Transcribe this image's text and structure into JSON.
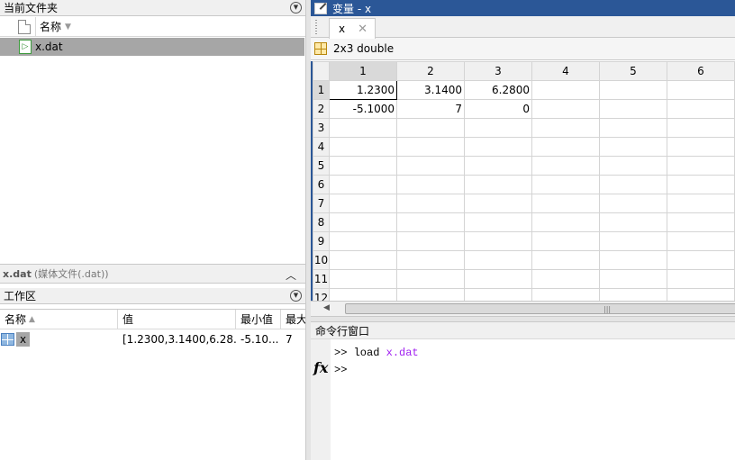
{
  "current_folder": {
    "title": "当前文件夹",
    "column_name": "名称",
    "files": [
      {
        "name": "x.dat"
      }
    ],
    "details_name": "x.dat",
    "details_desc": "(媒体文件(.dat))"
  },
  "workspace": {
    "title": "工作区",
    "columns": {
      "name": "名称",
      "value": "值",
      "min": "最小值",
      "max": "最大"
    },
    "rows": [
      {
        "name": "x",
        "value": "[1.2300,3.1400,6.28...",
        "min": "-5.10...",
        "max": "7"
      }
    ]
  },
  "variable_editor": {
    "title": "变量 - x",
    "tab_label": "x",
    "info": "2x3 double",
    "col_headers": [
      "1",
      "2",
      "3",
      "4",
      "5",
      "6"
    ],
    "row_headers": [
      "1",
      "2",
      "3",
      "4",
      "5",
      "6",
      "7",
      "8",
      "9",
      "10",
      "11",
      "12"
    ],
    "cells": [
      [
        "1.2300",
        "3.1400",
        "6.2800",
        "",
        "",
        ""
      ],
      [
        "-5.1000",
        "7",
        "0",
        "",
        "",
        ""
      ]
    ]
  },
  "command_window": {
    "title": "命令行窗口",
    "prompt": ">>",
    "history": [
      {
        "cmd": "load",
        "arg": "x.dat"
      }
    ],
    "fx_label": "fx"
  },
  "colors": {
    "title_bar": "#2b5797",
    "selection": "#a6a6a6",
    "string_arg": "#a020f0"
  }
}
